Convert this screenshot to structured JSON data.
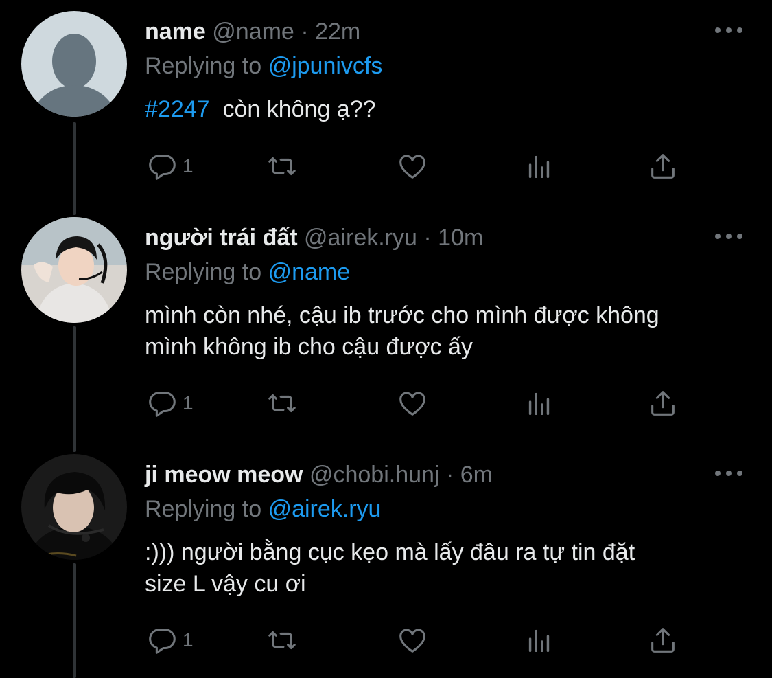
{
  "colors": {
    "background": "#000000",
    "text_primary": "#e7e9ea",
    "text_secondary": "#71767b",
    "link": "#1d9bf0",
    "thread_line": "#2f3336"
  },
  "icons": {
    "reply": "reply-icon",
    "retweet": "retweet-icon",
    "like": "like-icon",
    "views": "views-icon",
    "share": "share-icon",
    "more": "more-icon"
  },
  "tweets": [
    {
      "display_name": "name",
      "handle": "@name",
      "separator": "·",
      "time": "22m",
      "replying_prefix": "Replying to",
      "replying_to": "@jpunivcfs",
      "hashtag": "#2247",
      "text": "còn không ạ??",
      "reply_count": "1"
    },
    {
      "display_name": "người trái đất",
      "handle": "@airek.ryu",
      "separator": "·",
      "time": "10m",
      "replying_prefix": "Replying to",
      "replying_to": "@name",
      "text_line1": "mình còn nhé, cậu ib trước cho mình được không",
      "text_line2": "mình không ib cho cậu được ấy",
      "reply_count": "1"
    },
    {
      "display_name": "ji meow meow",
      "handle": "@chobi.hunj",
      "separator": "·",
      "time": "6m",
      "replying_prefix": "Replying to",
      "replying_to": "@airek.ryu",
      "text_line1": ":))) người bằng cục kẹo mà lấy đâu ra tự tin đặt",
      "text_line2": "size L vậy cu ơi",
      "reply_count": "1"
    }
  ]
}
